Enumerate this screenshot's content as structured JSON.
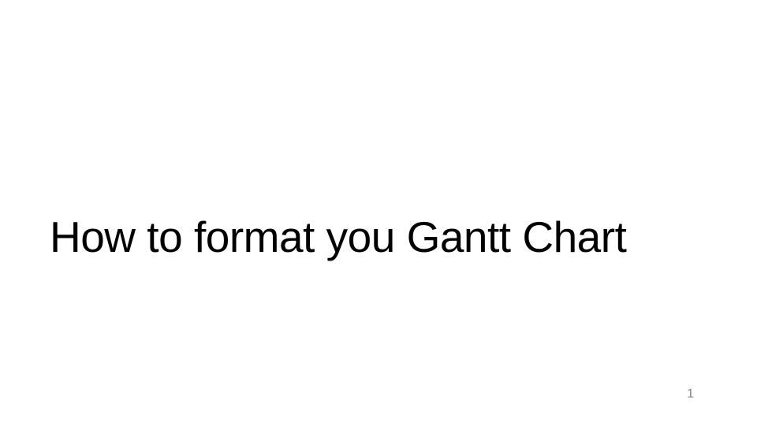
{
  "slide": {
    "title": "How to format you Gantt Chart",
    "page_number": "1"
  }
}
